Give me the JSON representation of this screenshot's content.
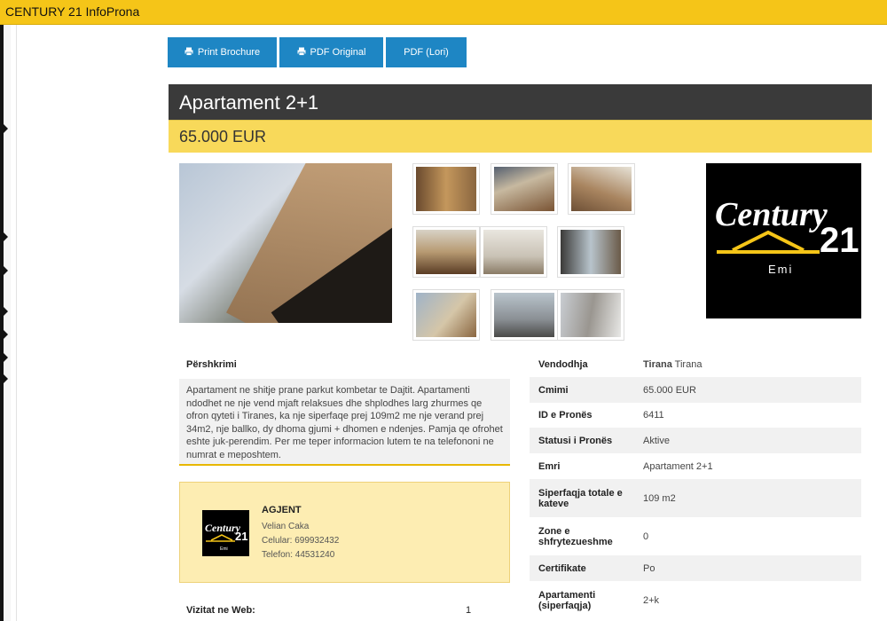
{
  "app": {
    "title": "CENTURY 21 InfoProna"
  },
  "toolbar": {
    "print_brochure": "Print Brochure",
    "pdf_original": "PDF Original",
    "pdf_lori": "PDF (Lori)"
  },
  "listing": {
    "title": "Apartament 2+1",
    "price": "65.000 EUR"
  },
  "brand": {
    "logo_text": "Century 21",
    "office": "Emi",
    "color_gold": "#f5c518",
    "color_blue": "#1e86c4",
    "color_dark": "#3a3a3a"
  },
  "description": {
    "heading": "Përshkrimi",
    "text": "Apartament ne shitje prane parkut kombetar te Dajtit. Apartamenti ndodhet ne nje vend mjaft relaksues dhe shplodhes larg zhurmes qe ofron qyteti i Tiranes, ka nje siperfaqe prej 109m2 me nje verand prej 34m2, nje ballko, dy dhoma gjumi + dhomen e ndenjes. Pamja qe ofrohet eshte juk-perendim. Per me teper informacion lutem te na telefononi ne numrat e meposhtem."
  },
  "agent": {
    "title": "AGJENT",
    "name": "Velian Caka",
    "mobile": "Celular: 699932432",
    "phone": "Telefon: 44531240"
  },
  "visits": {
    "label": "Vizitat ne Web:",
    "value": "1"
  },
  "details": [
    {
      "label": "Vendodhja",
      "value_bold": "Tirana",
      "value": "Tirana"
    },
    {
      "label": "Cmimi",
      "value": "65.000 EUR"
    },
    {
      "label": "ID e Pronës",
      "value": "6411"
    },
    {
      "label": "Statusi i Pronës",
      "value": "Aktive"
    },
    {
      "label": "Emri",
      "value": "Apartament 2+1"
    },
    {
      "label": "Siperfaqja totale e kateve",
      "value": "109 m2"
    },
    {
      "label": "Zone e shfrytezueshme",
      "value": "0"
    },
    {
      "label": "Certifikate",
      "value": "Po"
    },
    {
      "label": "Apartamenti (siperfaqja)",
      "value": "2+k"
    }
  ]
}
